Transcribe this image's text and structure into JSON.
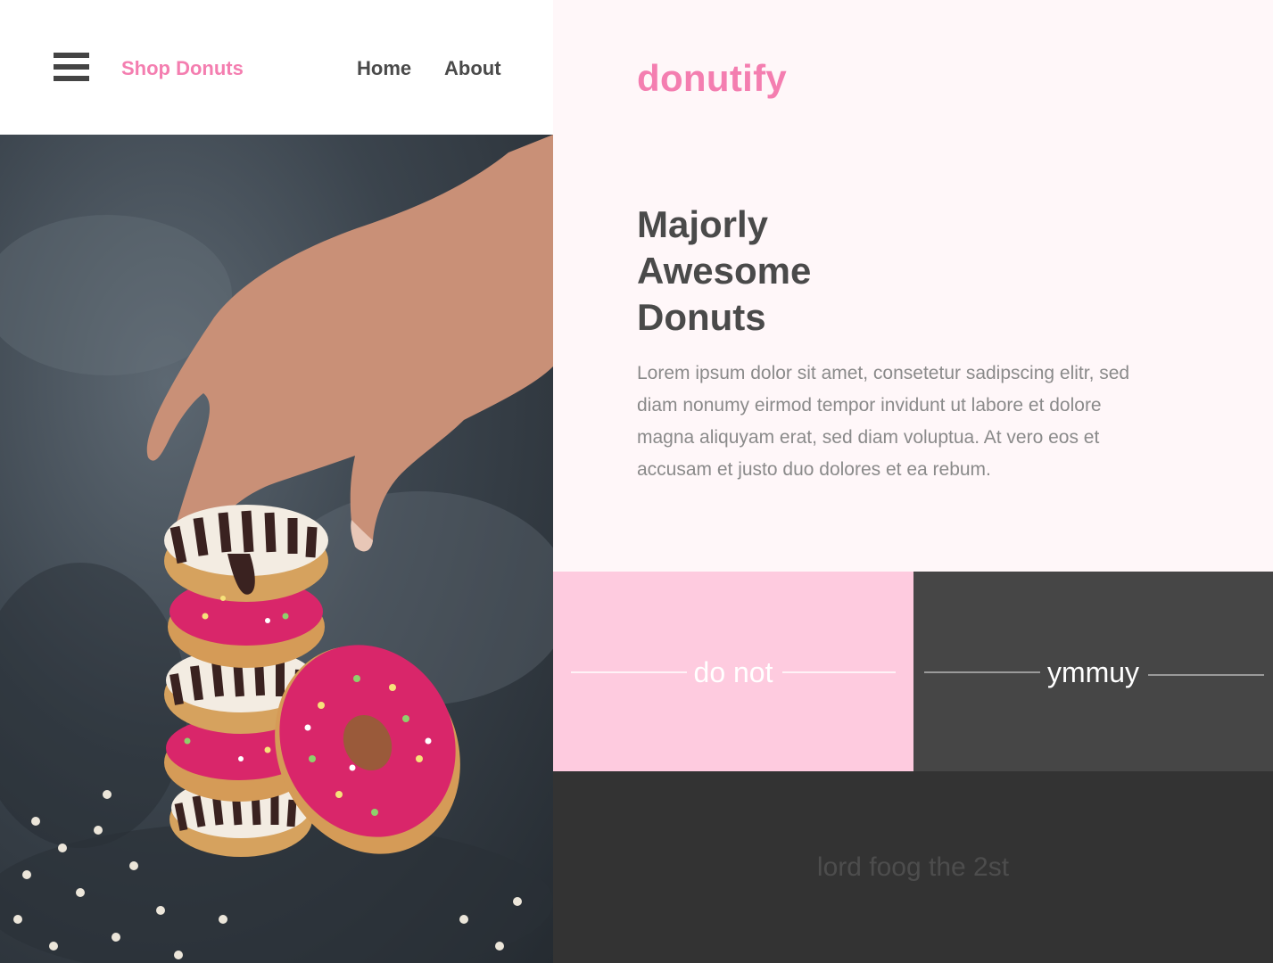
{
  "nav": {
    "menu_icon": "hamburger-menu-icon",
    "shop_label": "Shop Donuts",
    "home_label": "Home",
    "about_label": "About"
  },
  "hero": {
    "image_icon": "donut-stack-photo",
    "brand": "donutify",
    "headline": [
      "Majorly",
      "Awesome",
      "Donuts"
    ],
    "body": "Lorem ipsum dolor sit amet, consetetur sadipscing elitr, sed diam nonumy eirmod tempor invidunt ut labore et dolore magna aliquyam erat, sed diam voluptua. At vero eos et accusam et justo duo dolores et ea rebum."
  },
  "tiles": [
    {
      "label": "do not",
      "background": "#fecbdf"
    },
    {
      "label": "ymmuy",
      "background": "#464646"
    }
  ],
  "footer": {
    "credit": "lord foog the 2st"
  },
  "colors": {
    "accent": "#f47eb0",
    "text_dark": "#4a4a4a",
    "text_muted": "#8a8a8a",
    "panel_bg": "#fff7f9",
    "footer_bg": "#333333"
  }
}
